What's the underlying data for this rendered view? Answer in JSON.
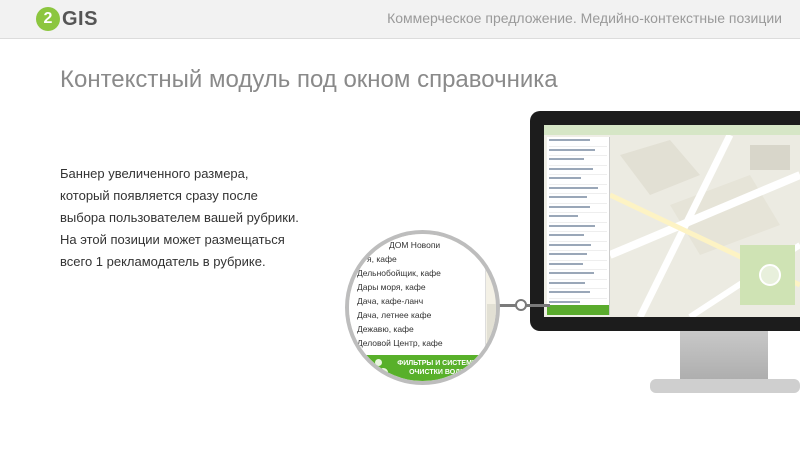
{
  "header": {
    "logo_number": "2",
    "logo_text": "GIS",
    "title": "Коммерческое предложение. Медийно-контекстные позиции"
  },
  "page_title": "Контекстный модуль под окном справочника",
  "description_lines": [
    "Баннер увеличенного размера,",
    "который появляется сразу после",
    "выбора пользователем вашей рубрики.",
    "На этой позиции может размещаться",
    "всего 1 рекламодатель в рубрике."
  ],
  "magnifier": {
    "items": [
      "ДОМ Новопи",
      "я, кафе",
      "Дельнобойщик, кафе",
      "Дары моря, кафе",
      "Дача, кафе-ланч",
      "Дача, летнее кафе",
      "Дежавю, кафе",
      "Деловой Центр, кафе"
    ],
    "banner_text": "ФИЛЬТРЫ И СИСТЕМЫ ОЧИСТКИ ВОДЫ"
  },
  "colors": {
    "brand_green": "#8cc63f",
    "banner_green": "#58b02a",
    "title_gray": "#8a8a8a"
  }
}
